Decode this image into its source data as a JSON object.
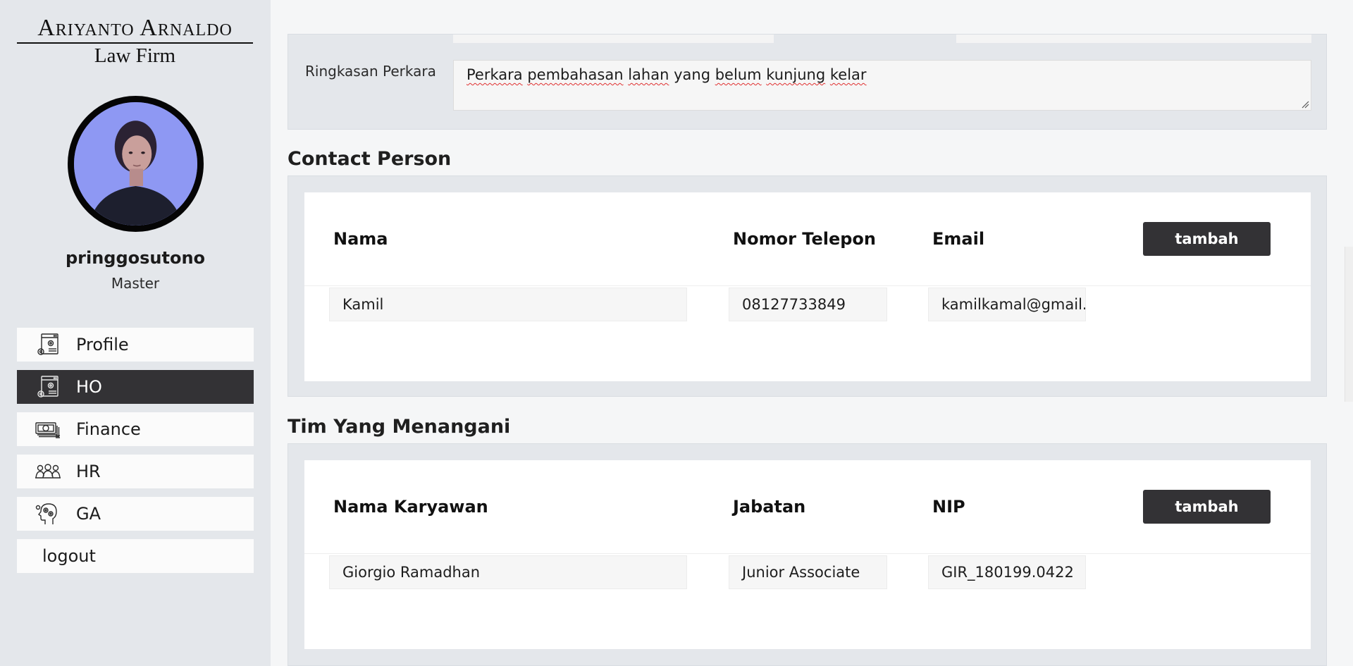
{
  "brand": {
    "name": "Ariyanto Arnaldo",
    "subtitle": "Law Firm"
  },
  "user": {
    "name": "pringgosutono",
    "role": "Master"
  },
  "nav": [
    {
      "label": "Profile",
      "icon": "settings-window-icon",
      "active": false
    },
    {
      "label": "HO",
      "icon": "settings-window-icon",
      "active": true
    },
    {
      "label": "Finance",
      "icon": "money-stack-icon",
      "active": false
    },
    {
      "label": "HR",
      "icon": "people-group-icon",
      "active": false
    },
    {
      "label": "GA",
      "icon": "head-gears-icon",
      "active": false
    },
    {
      "label": "logout",
      "icon": "",
      "active": false
    }
  ],
  "ringkasan": {
    "label": "Ringkasan Perkara",
    "value_parts": [
      "Perkara",
      " ",
      "pembahasan",
      " ",
      "lahan",
      " yang ",
      "belum",
      " ",
      "kunjung",
      " ",
      "kelar"
    ]
  },
  "contact": {
    "title": "Contact Person",
    "headers": {
      "nama": "Nama",
      "telepon": "Nomor Telepon",
      "email": "Email"
    },
    "button": "tambah",
    "row": {
      "nama": "Kamil",
      "telepon": "08127733849",
      "email": "kamilkamal@gmail.com"
    }
  },
  "tim": {
    "title": "Tim Yang Menangani",
    "headers": {
      "nama": "Nama Karyawan",
      "jabatan": "Jabatan",
      "nip": "NIP"
    },
    "button": "tambah",
    "row": {
      "nama": "Giorgio Ramadhan",
      "jabatan": "Junior Associate",
      "nip": "GIR_180199.0422"
    }
  },
  "colors": {
    "sidebar_bg": "#e4e7eb",
    "active_nav": "#333235",
    "button_bg": "#333235",
    "page_bg": "#f5f6f7"
  }
}
